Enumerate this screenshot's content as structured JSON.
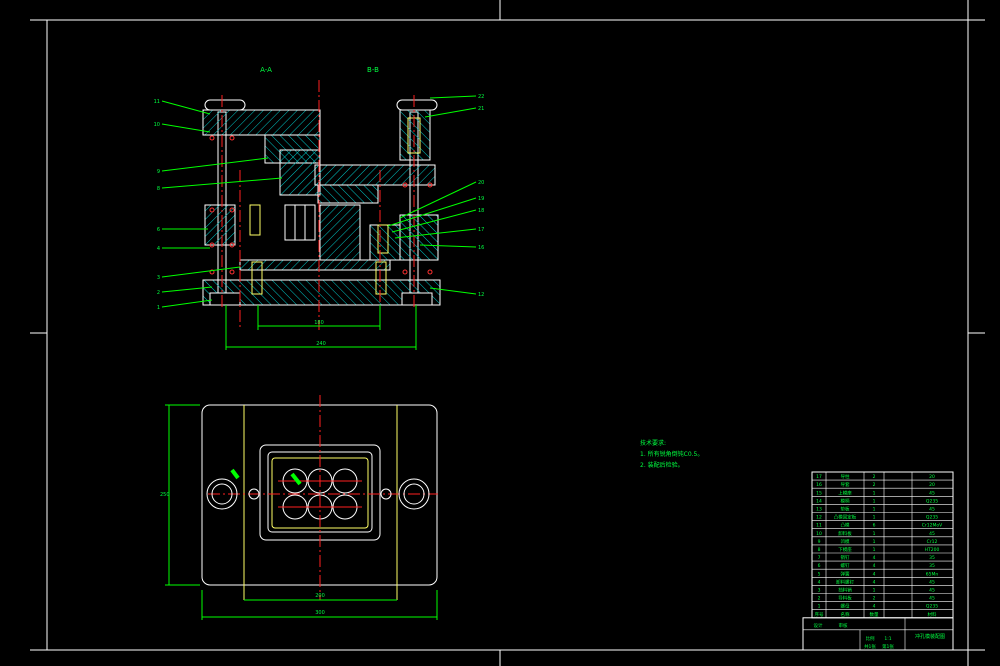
{
  "colors": {
    "background": "#000000",
    "frame": "#ffffff",
    "part": "#ffffff",
    "hatch": "#00c8c8",
    "centerline": "#ff2020",
    "dimension": "#00ff00",
    "leader": "#00ff00",
    "highlight": "#ffff66",
    "notes": "#00ff40"
  },
  "section_labels": [
    "A-A",
    "B-B"
  ],
  "left_callouts": [
    "1",
    "2",
    "3",
    "4",
    "5",
    "6",
    "7",
    "8",
    "9",
    "10",
    "11"
  ],
  "right_callouts": [
    "12",
    "13",
    "14",
    "15",
    "16",
    "17",
    "18",
    "19",
    "20",
    "21",
    "22"
  ],
  "dimensions": {
    "inner_width": "180",
    "outer_width": "240",
    "plan_height": "250",
    "plan_inner": "200",
    "plan_outer": "300"
  },
  "tech_notes": {
    "title": "技术要求:",
    "lines": [
      "1. 所有锐角倒钝C0.5。",
      "2. 装配后检验。"
    ]
  },
  "bom": {
    "rows": [
      [
        "17",
        "导柱",
        "2",
        "20"
      ],
      [
        "16",
        "导套",
        "2",
        "20"
      ],
      [
        "15",
        "上模座",
        "1",
        "45"
      ],
      [
        "14",
        "模柄",
        "1",
        "Q235"
      ],
      [
        "13",
        "垫板",
        "1",
        "45"
      ],
      [
        "12",
        "凸模固定板",
        "1",
        "Q235"
      ],
      [
        "11",
        "凸模",
        "6",
        "Cr12MoV"
      ],
      [
        "10",
        "卸料板",
        "1",
        "45"
      ],
      [
        "9",
        "凹模",
        "1",
        "Cr12"
      ],
      [
        "8",
        "下模座",
        "1",
        "HT200"
      ],
      [
        "7",
        "销钉",
        "4",
        "35"
      ],
      [
        "6",
        "螺钉",
        "4",
        "35"
      ],
      [
        "5",
        "弹簧",
        "4",
        "65Mn"
      ],
      [
        "4",
        "卸料螺钉",
        "4",
        "45"
      ],
      [
        "3",
        "挡料销",
        "1",
        "45"
      ],
      [
        "2",
        "导料板",
        "2",
        "45"
      ],
      [
        "1",
        "螺母",
        "4",
        "Q235"
      ]
    ],
    "header": [
      "序号",
      "名称",
      "数量",
      "材料"
    ],
    "drawing_title": "冲孔模装配图",
    "footer": [
      "设计",
      "审核",
      "比例",
      "1:1",
      "共1张",
      "第1张"
    ]
  }
}
